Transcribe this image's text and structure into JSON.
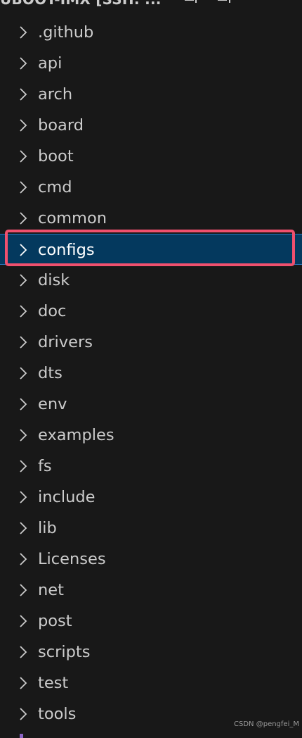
{
  "explorer": {
    "title": "UBOOT-IMX [SSH: ...",
    "actions": [
      {
        "name": "new-file-icon"
      },
      {
        "name": "new-folder-icon"
      },
      {
        "name": "refresh-icon"
      },
      {
        "name": "collapse-all-icon"
      }
    ]
  },
  "tree": {
    "items": [
      {
        "label": ".github"
      },
      {
        "label": "api"
      },
      {
        "label": "arch"
      },
      {
        "label": "board"
      },
      {
        "label": "boot"
      },
      {
        "label": "cmd"
      },
      {
        "label": "common"
      },
      {
        "label": "configs",
        "selected": true
      },
      {
        "label": "disk"
      },
      {
        "label": "doc"
      },
      {
        "label": "drivers"
      },
      {
        "label": "dts"
      },
      {
        "label": "env"
      },
      {
        "label": "examples"
      },
      {
        "label": "fs"
      },
      {
        "label": "include"
      },
      {
        "label": "lib"
      },
      {
        "label": "Licenses"
      },
      {
        "label": "net"
      },
      {
        "label": "post"
      },
      {
        "label": "scripts"
      },
      {
        "label": "test"
      },
      {
        "label": "tools"
      }
    ]
  },
  "watermark": "CSDN @pengfei_M",
  "colors": {
    "background": "#181818",
    "selection": "#04395e",
    "highlight": "#f0506e"
  }
}
